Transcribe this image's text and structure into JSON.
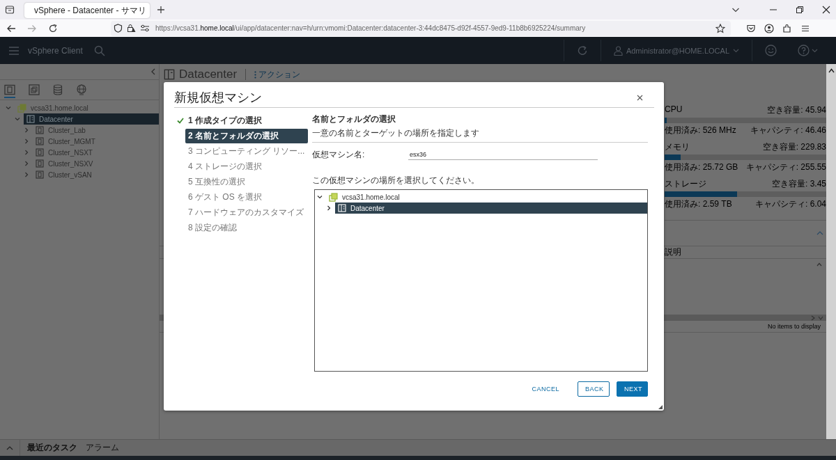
{
  "browser": {
    "tab": {
      "title": "vSphere - Datacenter - サマリ",
      "selected": true
    },
    "address": "https://vcsa31.**home.local**/ui/app/datacenter:nav=h/urn:vmomi:Datacenter:datacenter-3:44dc8475-d92f-4557-9ed9-11b8b6925224/summary"
  },
  "header": {
    "app_name": "vSphere Client",
    "user": "Administrator@HOME.LOCAL"
  },
  "sidebar": {
    "tabs": [
      {
        "kind": "hosts",
        "selected": true
      },
      {
        "kind": "vms",
        "selected": false
      },
      {
        "kind": "storage",
        "selected": false
      },
      {
        "kind": "network",
        "selected": false
      }
    ],
    "tree": [
      {
        "label": "vcsa31.home.local",
        "kind": "vcenter",
        "expanded": true,
        "selected": false,
        "children": [
          {
            "label": "Datacenter",
            "kind": "datacenter",
            "expanded": true,
            "selected": true,
            "children": [
              {
                "label": "Cluster_Lab",
                "kind": "cluster",
                "expanded": false,
                "selected": false
              },
              {
                "label": "Cluster_MGMT",
                "kind": "cluster",
                "expanded": false,
                "selected": false
              },
              {
                "label": "Cluster_NSXT",
                "kind": "cluster",
                "expanded": false,
                "selected": false
              },
              {
                "label": "Cluster_NSXV",
                "kind": "cluster",
                "expanded": false,
                "selected": false
              },
              {
                "label": "Cluster_vSAN",
                "kind": "cluster",
                "expanded": false,
                "selected": false
              }
            ]
          }
        ]
      }
    ]
  },
  "main": {
    "title": "Datacenter",
    "actions": "アクション",
    "resources": [
      {
        "name": "CPU",
        "free": "空き容量: 45.94",
        "level": 0.015,
        "used": "使用済み: 526 MHz",
        "capacity": "キャパシティ: 46.46"
      },
      {
        "name": "メモリ",
        "free": "空き容量: 229.83",
        "level": 0.1,
        "used": "使用済み: 25.72 GB",
        "capacity": "キャパシティ: 255.55"
      },
      {
        "name": "ストレージ",
        "free": "空き容量: 3.45",
        "level": 0.45,
        "used": "使用済み: 2.59 TB",
        "capacity": "キャパシティ: 6.04"
      }
    ],
    "table": {
      "column": "説明",
      "empty": "No items to display"
    }
  },
  "dialog": {
    "title": "新規仮想マシン",
    "steps": [
      {
        "label": "1 作成タイプの選択",
        "completed": true,
        "selected": false
      },
      {
        "label": "2 名前とフォルダの選択",
        "completed": false,
        "selected": true
      },
      {
        "label": "3 コンピューティング リソー...",
        "completed": false,
        "selected": false
      },
      {
        "label": "4 ストレージの選択",
        "completed": false,
        "selected": false
      },
      {
        "label": "5 互換性の選択",
        "completed": false,
        "selected": false
      },
      {
        "label": "6 ゲスト OS を選択",
        "completed": false,
        "selected": false
      },
      {
        "label": "7 ハードウェアのカスタマイズ",
        "completed": false,
        "selected": false
      },
      {
        "label": "8 設定の確認",
        "completed": false,
        "selected": false
      }
    ],
    "heading": "名前とフォルダの選択",
    "subheading": "一意の名前とターゲットの場所を指定します",
    "name_label": "仮想マシン名:",
    "name_value": "esx36",
    "location_prompt": "この仮想マシンの場所を選択してください。",
    "tree": [
      {
        "label": "vcsa31.home.local",
        "kind": "vcenter",
        "expanded": true,
        "selected": false,
        "children": [
          {
            "label": "Datacenter",
            "kind": "datacenter",
            "expanded": false,
            "selected": true
          }
        ]
      }
    ],
    "buttons": [
      {
        "label": "CANCEL",
        "kind": "flat"
      },
      {
        "label": "BACK",
        "kind": "outline"
      },
      {
        "label": "NEXT",
        "kind": "primary"
      }
    ]
  },
  "bottom_bar": {
    "tabs": [
      {
        "label": "最近のタスク",
        "selected": true
      },
      {
        "label": "アラーム",
        "selected": false
      }
    ]
  }
}
